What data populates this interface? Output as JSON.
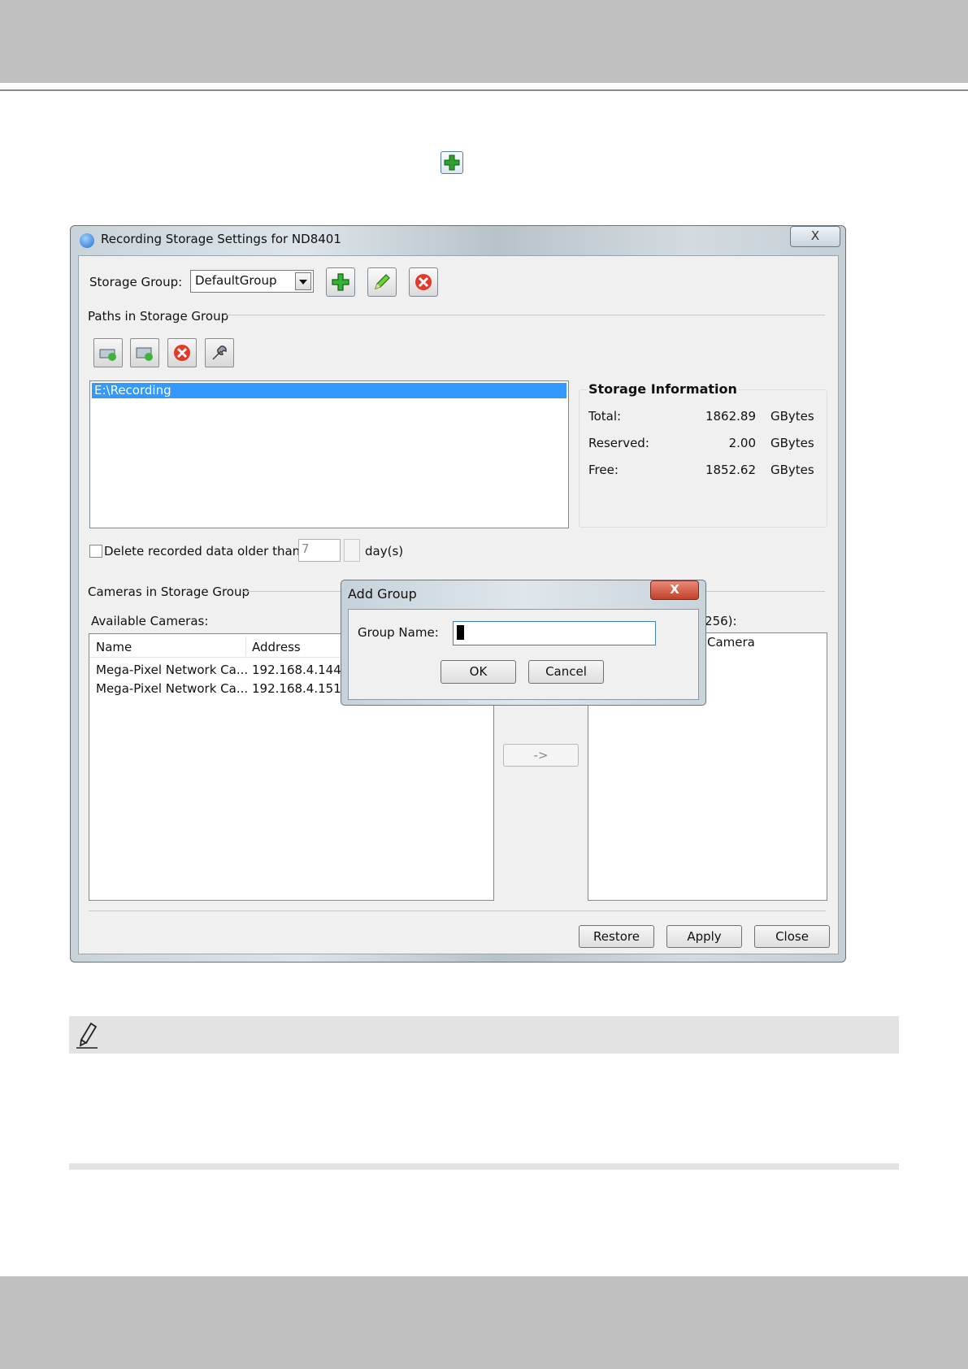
{
  "colors": {
    "header_band": "#bfc0bf",
    "selection": "#3399ff",
    "note_bar": "#e3e3e3"
  },
  "doc": {
    "inline_icon": "green-plus-icon",
    "note_icon": "pencil-note-icon"
  },
  "window": {
    "title": "Recording Storage Settings for ND8401",
    "close_label": "X",
    "storage_group_label": "Storage Group:",
    "storage_group_value": "DefaultGroup",
    "group_toolbar": [
      "add-icon",
      "edit-icon",
      "delete-icon"
    ],
    "paths_section_label": "Paths in Storage Group",
    "path_toolbar": [
      "add-path-icon",
      "add-network-path-icon",
      "remove-path-icon",
      "path-settings-icon"
    ],
    "paths": [
      "E:\\Recording"
    ],
    "storage_info": {
      "title": "Storage Information",
      "rows": [
        {
          "label": "Total:",
          "value": "1862.89",
          "unit": "GBytes"
        },
        {
          "label": "Reserved:",
          "value": "2.00",
          "unit": "GBytes"
        },
        {
          "label": "Free:",
          "value": "1852.62",
          "unit": "GBytes"
        }
      ]
    },
    "delete_older": {
      "label": "Delete recorded data older than",
      "days": "7",
      "unit": "day(s)",
      "checked": false
    },
    "cameras_section_label": "Cameras in Storage Group",
    "available_label": "Available Cameras:",
    "columns": [
      "Name",
      "Address"
    ],
    "available_cameras": [
      {
        "name": "Mega-Pixel Network Ca...",
        "address": "192.168.4.144"
      },
      {
        "name": "Mega-Pixel Network Ca...",
        "address": "192.168.4.151"
      }
    ],
    "move_right_label": "->",
    "selected_label_partial": "/256):",
    "selected_item_partial": "Camera",
    "buttons": {
      "restore": "Restore",
      "apply": "Apply",
      "close": "Close"
    }
  },
  "dialog": {
    "title": "Add Group",
    "close_label": "X",
    "group_name_label": "Group Name:",
    "group_name_value": "",
    "ok": "OK",
    "cancel": "Cancel"
  }
}
